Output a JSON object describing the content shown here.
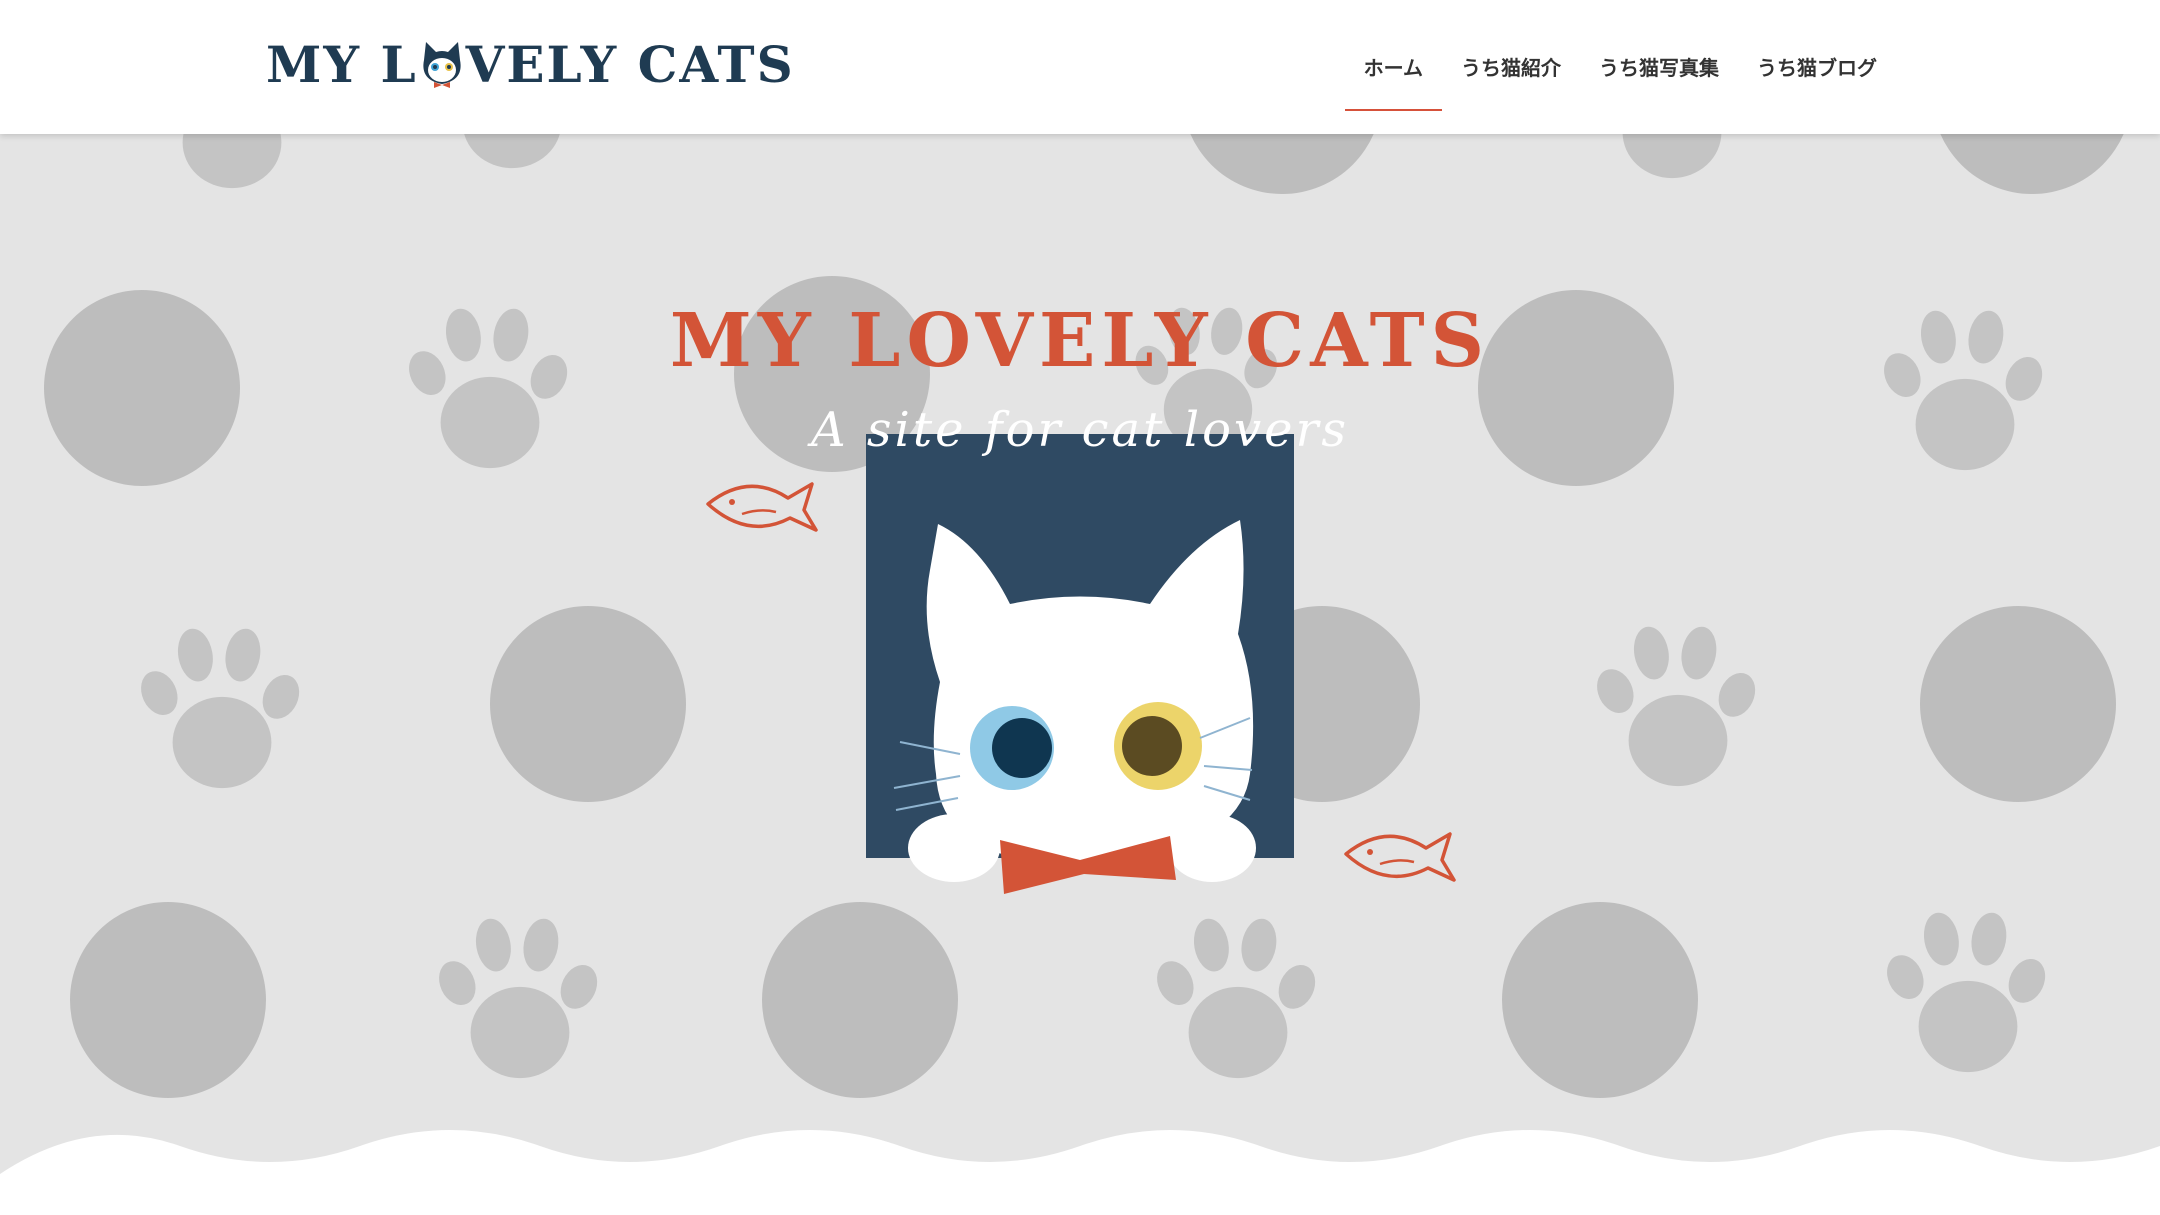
{
  "site": {
    "logo_text_left": "MY L",
    "logo_text_right": "VELY CATS"
  },
  "nav": {
    "items": [
      {
        "label": "ホーム",
        "active": true
      },
      {
        "label": "うち猫紹介",
        "active": false
      },
      {
        "label": "うち猫写真集",
        "active": false
      },
      {
        "label": "うち猫ブログ",
        "active": false
      }
    ]
  },
  "hero": {
    "title": "MY LOVELY CATS",
    "subtitle": "A site for cat lovers"
  },
  "colors": {
    "brand_navy": "#1f3b52",
    "accent_red": "#d35437",
    "hero_bg": "#e4e4e4",
    "pattern_gray": "#bdbdbd",
    "frame_navy": "#2f4a63"
  },
  "icons": [
    "cat-logo-icon",
    "paw-print-icon",
    "fish-icon",
    "cat-illustration"
  ]
}
